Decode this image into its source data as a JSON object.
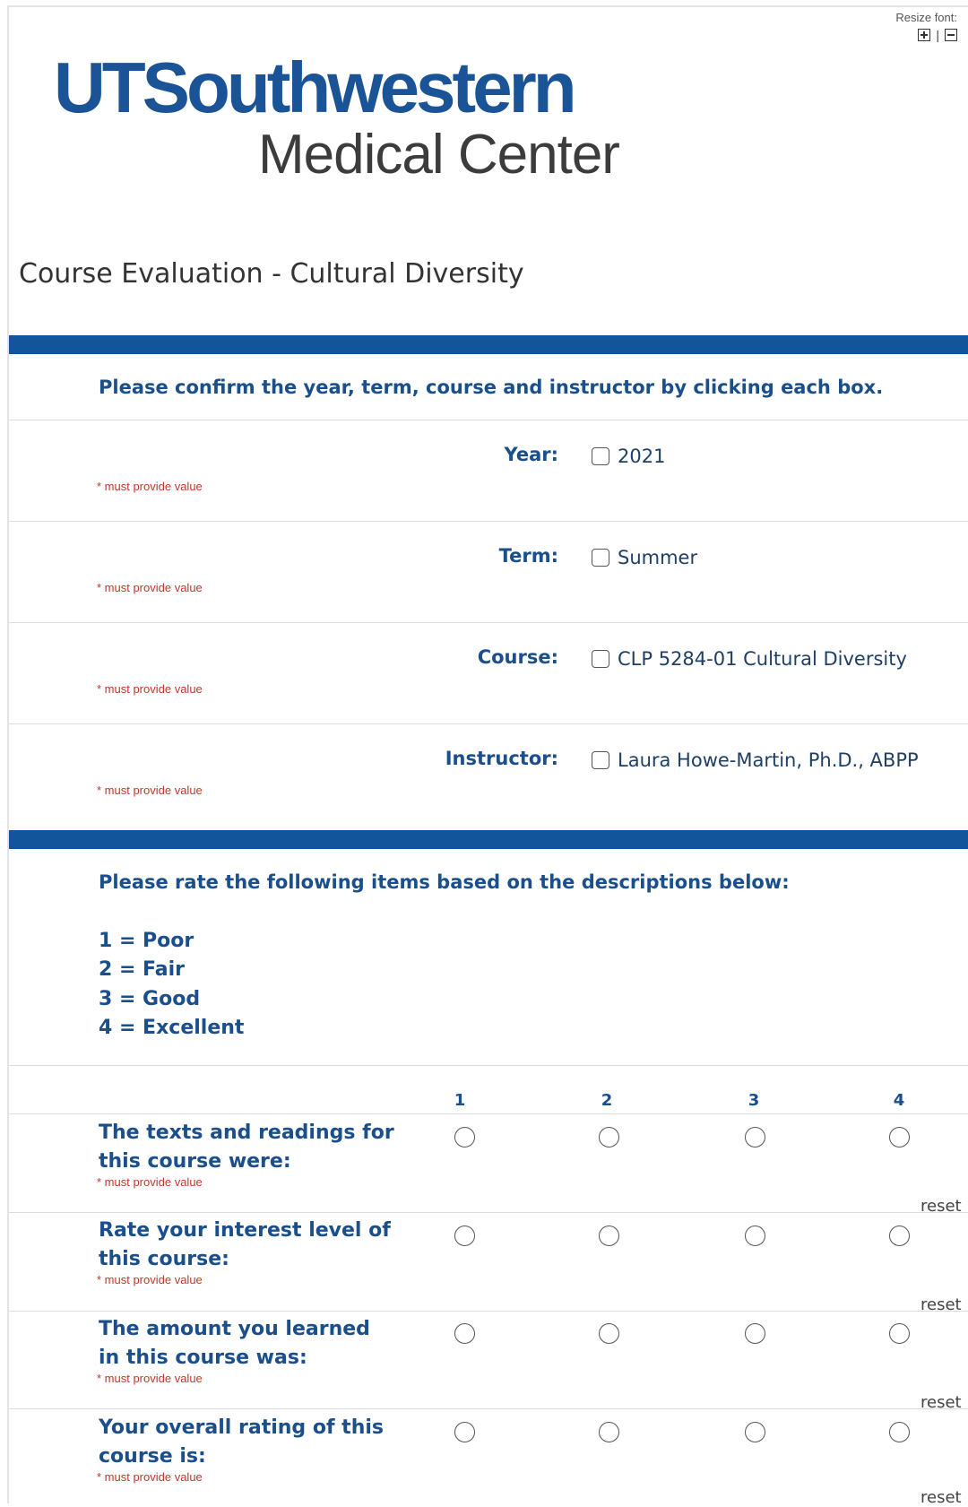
{
  "header": {
    "resize_font_label": "Resize font:",
    "resize_separator": "|",
    "logo_line1": "UTSouthwestern",
    "logo_line2": "Medical Center",
    "brand_color": "#13559a"
  },
  "page_title": "Course Evaluation - Cultural Diversity",
  "confirm_section": {
    "heading": "Please confirm the year, term, course and instructor by clicking each box.",
    "fields": [
      {
        "label": "Year:",
        "option": "2021",
        "required_note": "* must provide value"
      },
      {
        "label": "Term:",
        "option": "Summer",
        "required_note": "* must provide value"
      },
      {
        "label": "Course:",
        "option": "CLP 5284-01 Cultural Diversity",
        "required_note": "* must provide value"
      },
      {
        "label": "Instructor:",
        "option": "Laura Howe-Martin, Ph.D., ABPP",
        "required_note": "* must provide value"
      }
    ]
  },
  "rating_section": {
    "heading": "Please rate the following items based on the descriptions below:",
    "scale": [
      "1 = Poor",
      "2 = Fair",
      "3 = Good",
      "4 = Excellent"
    ],
    "columns": [
      "1",
      "2",
      "3",
      "4"
    ],
    "questions": [
      {
        "label": "The texts and readings for this course were:",
        "required_note": "* must provide value",
        "reset": "reset"
      },
      {
        "label": "Rate your interest level of this course:",
        "required_note": "* must provide value",
        "reset": "reset"
      },
      {
        "label": "The amount you learned in this course was:",
        "required_note": "* must provide value",
        "reset": "reset"
      },
      {
        "label": "Your overall rating of this course is:",
        "required_note": "* must provide value",
        "reset": "reset"
      }
    ]
  }
}
